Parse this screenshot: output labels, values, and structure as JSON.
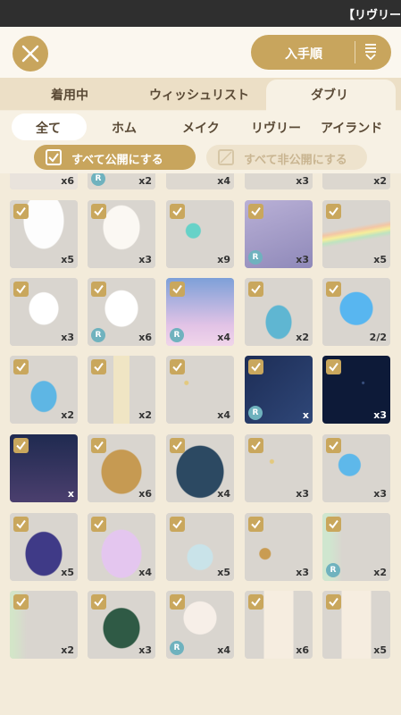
{
  "topbar": {
    "title": "【リヴリー"
  },
  "header": {
    "sort_label": "入手順"
  },
  "tabs": [
    "着用中",
    "ウィッシュリスト",
    "ダブリ"
  ],
  "filters": [
    "全て",
    "ホム",
    "メイク",
    "リヴリー",
    "アイランド"
  ],
  "toggles": {
    "public_all": "すべて公開にする",
    "private_all": "すべて非公開にする"
  },
  "items": [
    {
      "count": "x6",
      "r": false
    },
    {
      "count": "x2",
      "r": true
    },
    {
      "count": "x4",
      "r": false
    },
    {
      "count": "x3",
      "r": false
    },
    {
      "count": "x2",
      "r": false
    },
    {
      "count": "x5",
      "r": false
    },
    {
      "count": "x3",
      "r": false
    },
    {
      "count": "x9",
      "r": false
    },
    {
      "count": "x3",
      "r": true
    },
    {
      "count": "x5",
      "r": false
    },
    {
      "count": "x3",
      "r": false
    },
    {
      "count": "x6",
      "r": true
    },
    {
      "count": "x4",
      "r": true
    },
    {
      "count": "x2",
      "r": false
    },
    {
      "count": "2/2",
      "r": false
    },
    {
      "count": "x2",
      "r": false
    },
    {
      "count": "x2",
      "r": false
    },
    {
      "count": "x4",
      "r": false
    },
    {
      "count": "x",
      "r": true
    },
    {
      "count": "x3",
      "r": false
    },
    {
      "count": "x",
      "r": false
    },
    {
      "count": "x6",
      "r": false
    },
    {
      "count": "x4",
      "r": false
    },
    {
      "count": "x3",
      "r": false
    },
    {
      "count": "x3",
      "r": false
    },
    {
      "count": "x5",
      "r": false
    },
    {
      "count": "x4",
      "r": false
    },
    {
      "count": "x5",
      "r": false
    },
    {
      "count": "x3",
      "r": false
    },
    {
      "count": "x2",
      "r": true
    },
    {
      "count": "x2",
      "r": false
    },
    {
      "count": "x3",
      "r": false
    },
    {
      "count": "x4",
      "r": true
    },
    {
      "count": "x6",
      "r": false
    },
    {
      "count": "x5",
      "r": false
    }
  ],
  "colors": {
    "accent": "#c8a55d",
    "bg": "#f3ebda",
    "tile": "#d9d5cf",
    "r_badge": "#6fb2be"
  }
}
